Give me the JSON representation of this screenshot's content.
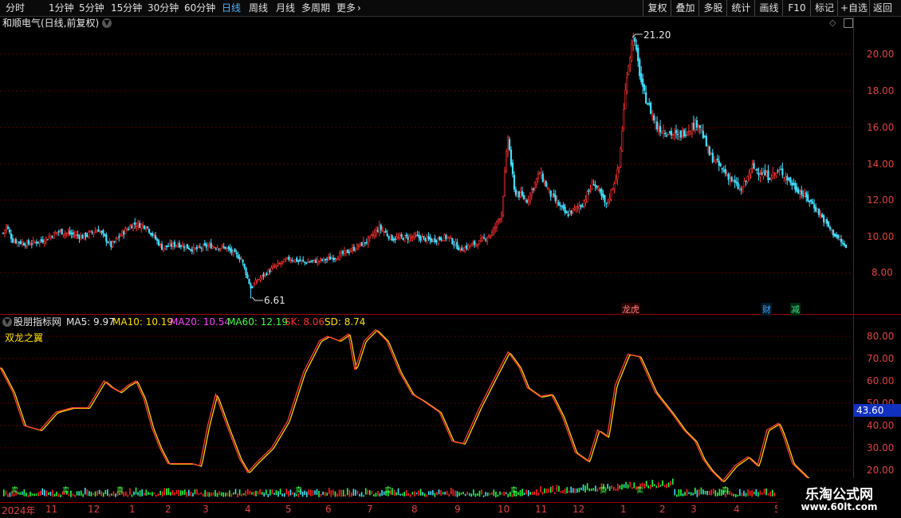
{
  "toolbar": {
    "timeframes": [
      {
        "label": "分时",
        "active": false
      },
      {
        "label": "1分钟",
        "active": false
      },
      {
        "label": "5分钟",
        "active": false
      },
      {
        "label": "15分钟",
        "active": false
      },
      {
        "label": "30分钟",
        "active": false
      },
      {
        "label": "60分钟",
        "active": false
      },
      {
        "label": "日线",
        "active": true
      },
      {
        "label": "周线",
        "active": false
      },
      {
        "label": "月线",
        "active": false
      },
      {
        "label": "多周期",
        "active": false
      },
      {
        "label": "更多",
        "active": false
      }
    ],
    "right_buttons": [
      "复权",
      "叠加",
      "多股",
      "统计",
      "画线",
      "F10",
      "标记",
      "+自选",
      "返回"
    ]
  },
  "stock": {
    "title": "和顺电气(日线,前复权)"
  },
  "price_axis": [
    "20.00",
    "18.00",
    "16.00",
    "14.00",
    "12.00",
    "10.00",
    "8.00"
  ],
  "annotations": {
    "high": "21.20",
    "low": "6.61"
  },
  "event_markers": [
    "龙虎",
    "财",
    "减"
  ],
  "indicator": {
    "name": "股朋指标网",
    "ma5": "MA5: 9.97",
    "ma10": "MA10: 10.19",
    "ma20": "MA20: 10.54",
    "ma60": "MA60: 12.19",
    "sk": "SK: 8.06",
    "sd": "SD: 8.74",
    "formula_name": "双龙之翼",
    "current_value": "43.60",
    "axis": [
      "80.00",
      "70.00",
      "60.00",
      "50.00",
      "40.00",
      "30.00",
      "20.00"
    ],
    "signal_label": "卖"
  },
  "dates": [
    "2024年",
    "11",
    "12",
    "1",
    "2",
    "3",
    "4",
    "5",
    "6",
    "7",
    "8",
    "9",
    "10",
    "11",
    "12",
    "1",
    "2",
    "3",
    "4",
    "5"
  ],
  "watermark": {
    "line1": "乐淘公式网",
    "line2": "www.60lt.com"
  },
  "colors": {
    "up": "#ff3030",
    "down": "#40e0ff",
    "sk": "#ffd700",
    "sd": "#ff4030",
    "grid": "#5a0000",
    "active_tab": "#4fb3ff"
  },
  "chart_data": {
    "type": "candlestick",
    "price_range": [
      6,
      22
    ],
    "price_high": 21.2,
    "price_low": 6.61,
    "close_anchors": [
      [
        0,
        10.2
      ],
      [
        2,
        10.6
      ],
      [
        6,
        9.8
      ],
      [
        15,
        9.6
      ],
      [
        25,
        9.8
      ],
      [
        35,
        10.3
      ],
      [
        50,
        10.0
      ],
      [
        60,
        10.4
      ],
      [
        68,
        9.5
      ],
      [
        75,
        10.2
      ],
      [
        82,
        10.7
      ],
      [
        90,
        10.6
      ],
      [
        100,
        9.4
      ],
      [
        110,
        9.6
      ],
      [
        120,
        9.3
      ],
      [
        130,
        9.5
      ],
      [
        140,
        9.4
      ],
      [
        150,
        8.8
      ],
      [
        156,
        7.2
      ],
      [
        160,
        7.6
      ],
      [
        170,
        8.3
      ],
      [
        180,
        8.8
      ],
      [
        190,
        8.6
      ],
      [
        200,
        8.7
      ],
      [
        210,
        8.9
      ],
      [
        220,
        9.3
      ],
      [
        230,
        9.8
      ],
      [
        237,
        10.5
      ],
      [
        245,
        9.9
      ],
      [
        260,
        10.0
      ],
      [
        270,
        9.8
      ],
      [
        280,
        10.0
      ],
      [
        288,
        9.3
      ],
      [
        300,
        9.7
      ],
      [
        308,
        10.2
      ],
      [
        314,
        11.3
      ],
      [
        318,
        15.5
      ],
      [
        322,
        12.5
      ],
      [
        330,
        12.0
      ],
      [
        338,
        13.5
      ],
      [
        345,
        12.3
      ],
      [
        355,
        11.2
      ],
      [
        365,
        11.8
      ],
      [
        372,
        13.0
      ],
      [
        380,
        11.7
      ],
      [
        388,
        13.8
      ],
      [
        393,
        19.0
      ],
      [
        397,
        21.0
      ],
      [
        403,
        18.0
      ],
      [
        412,
        16.0
      ],
      [
        425,
        15.5
      ],
      [
        438,
        16.3
      ],
      [
        445,
        14.5
      ],
      [
        455,
        13.5
      ],
      [
        465,
        12.5
      ],
      [
        472,
        13.8
      ],
      [
        482,
        13.3
      ],
      [
        490,
        13.6
      ],
      [
        498,
        12.8
      ],
      [
        510,
        11.8
      ],
      [
        522,
        10.3
      ],
      [
        531,
        9.4
      ]
    ],
    "indicator_range": [
      15,
      85
    ],
    "sd_anchors": [
      [
        0,
        66
      ],
      [
        8,
        55
      ],
      [
        15,
        40
      ],
      [
        25,
        38
      ],
      [
        35,
        46
      ],
      [
        45,
        48
      ],
      [
        55,
        48
      ],
      [
        65,
        60
      ],
      [
        70,
        57
      ],
      [
        75,
        55
      ],
      [
        80,
        58
      ],
      [
        85,
        60
      ],
      [
        90,
        52
      ],
      [
        95,
        39
      ],
      [
        100,
        30
      ],
      [
        105,
        23
      ],
      [
        115,
        23
      ],
      [
        120,
        23
      ],
      [
        125,
        22
      ],
      [
        130,
        40
      ],
      [
        135,
        54
      ],
      [
        142,
        40
      ],
      [
        150,
        25
      ],
      [
        155,
        19
      ],
      [
        160,
        23
      ],
      [
        170,
        30
      ],
      [
        180,
        42
      ],
      [
        190,
        64
      ],
      [
        200,
        78
      ],
      [
        205,
        80
      ],
      [
        212,
        78
      ],
      [
        218,
        81
      ],
      [
        222,
        65
      ],
      [
        228,
        78
      ],
      [
        235,
        83
      ],
      [
        242,
        78
      ],
      [
        250,
        64
      ],
      [
        258,
        54
      ],
      [
        265,
        51
      ],
      [
        275,
        46
      ],
      [
        283,
        33
      ],
      [
        290,
        32
      ],
      [
        300,
        48
      ],
      [
        310,
        62
      ],
      [
        318,
        73
      ],
      [
        325,
        66
      ],
      [
        330,
        57
      ],
      [
        338,
        53
      ],
      [
        345,
        54
      ],
      [
        352,
        44
      ],
      [
        360,
        28
      ],
      [
        368,
        24
      ],
      [
        374,
        38
      ],
      [
        380,
        35
      ],
      [
        385,
        58
      ],
      [
        393,
        72
      ],
      [
        400,
        71
      ],
      [
        410,
        55
      ],
      [
        420,
        46
      ],
      [
        428,
        38
      ],
      [
        435,
        33
      ],
      [
        440,
        25
      ],
      [
        445,
        20
      ],
      [
        452,
        15
      ],
      [
        460,
        22
      ],
      [
        468,
        26
      ],
      [
        474,
        22
      ],
      [
        480,
        38
      ],
      [
        487,
        41
      ],
      [
        490,
        36
      ],
      [
        496,
        23
      ],
      [
        506,
        16
      ],
      [
        514,
        13
      ]
    ]
  }
}
